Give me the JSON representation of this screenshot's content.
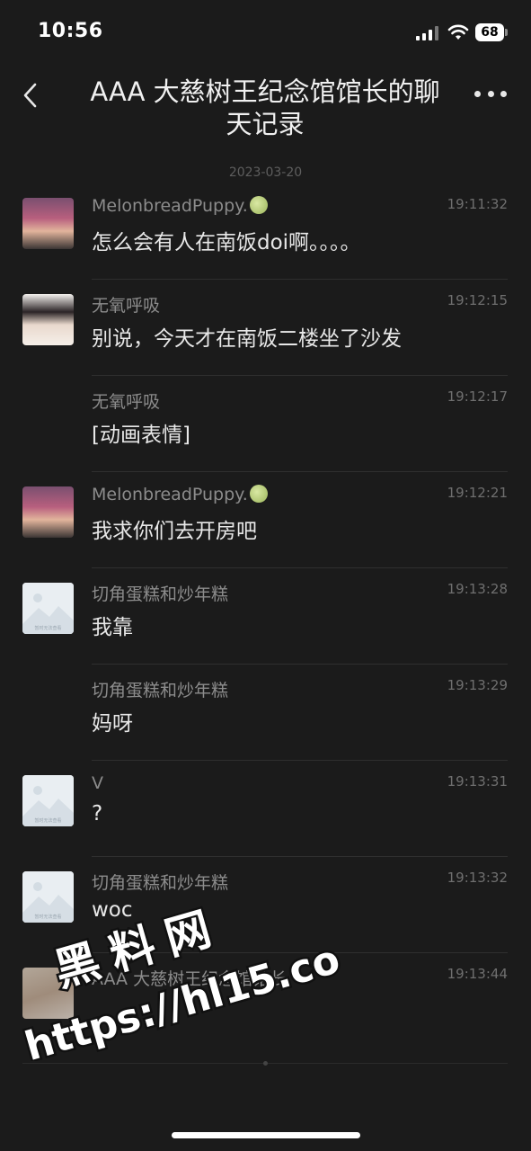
{
  "status_bar": {
    "time": "10:56",
    "battery": "68"
  },
  "header": {
    "title": "AAA 大慈树王纪念馆馆长的聊天记录"
  },
  "date": "2023-03-20",
  "messages": [
    {
      "sender": "MelonbreadPuppy.",
      "time": "19:11:32",
      "text": "怎么会有人在南饭doi啊。。。。"
    },
    {
      "sender": "无氧呼吸",
      "time": "19:12:15",
      "text": "别说，今天才在南饭二楼坐了沙发"
    },
    {
      "sender": "无氧呼吸",
      "time": "19:12:17",
      "text": "[动画表情]"
    },
    {
      "sender": "MelonbreadPuppy.",
      "time": "19:12:21",
      "text": "我求你们去开房吧"
    },
    {
      "sender": "切角蛋糕和炒年糕",
      "time": "19:13:28",
      "text": "我靠"
    },
    {
      "sender": "切角蛋糕和炒年糕",
      "time": "19:13:29",
      "text": "妈呀"
    },
    {
      "sender": "V",
      "time": "19:13:31",
      "text": "?"
    },
    {
      "sender": "切角蛋糕和炒年糕",
      "time": "19:13:32",
      "text": "woc"
    },
    {
      "sender": "AAA 大慈树王纪念馆馆长",
      "time": "19:13:44",
      "text": ""
    }
  ],
  "placeholder_caption": "暂时无法查看",
  "watermark": {
    "line1": "黑料网",
    "line2": "https://hl15.co"
  }
}
